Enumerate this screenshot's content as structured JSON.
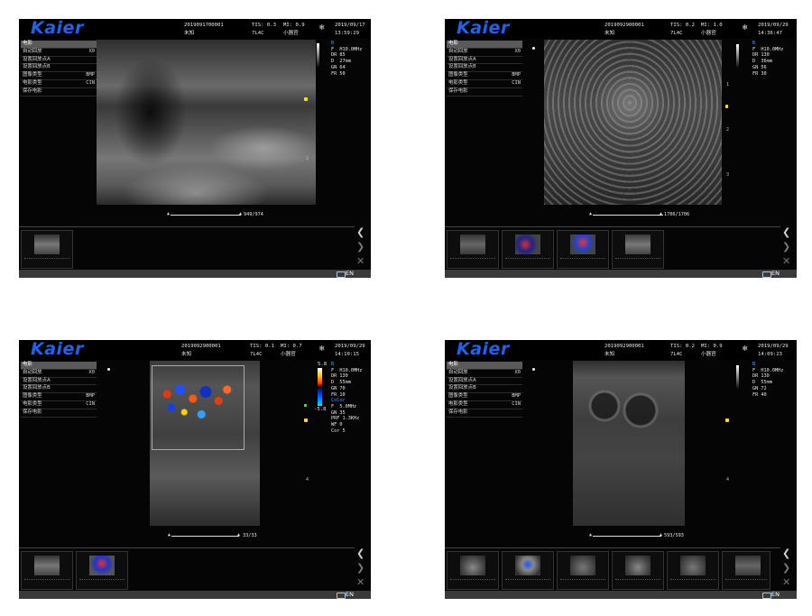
{
  "screens": [
    {
      "brand": "Kaier",
      "patient_id": "2019091700001",
      "patient_name": "未知",
      "tis": "TIS: 0.3",
      "mi": "MI: 0.9",
      "probe": "7L4C",
      "preset": "小器官",
      "date": "2019/09/17",
      "time": "13:59:29",
      "menu": [
        {
          "label": "电影",
          "value": ""
        },
        {
          "label": "自动回放",
          "value": "X0"
        },
        {
          "label": "设置回放点A",
          "value": ""
        },
        {
          "label": "设置回放点B",
          "value": ""
        },
        {
          "label": "图像类型",
          "value": "BMP"
        },
        {
          "label": "电影类型",
          "value": "CIN"
        },
        {
          "label": "保存电影",
          "value": ""
        }
      ],
      "params": [
        {
          "k": "B",
          "v": ""
        },
        {
          "k": "F",
          "v": "H10.0MHz"
        },
        {
          "k": "DR",
          "v": "85"
        },
        {
          "k": "D",
          "v": "27mm"
        },
        {
          "k": "GN",
          "v": "64"
        },
        {
          "k": "FR",
          "v": "50"
        }
      ],
      "depth_marks": [
        "1",
        "2"
      ],
      "cine_counter": "949/974",
      "thumbnails": 1,
      "lang": "EN"
    },
    {
      "brand": "Kaier",
      "patient_id": "2019092900001",
      "patient_name": "未知",
      "tis": "TIS: 0.2",
      "mi": "MI: 1.0",
      "probe": "7L4C",
      "preset": "小器官",
      "date": "2019/09/29",
      "time": "14:36:47",
      "menu": [
        {
          "label": "电影",
          "value": ""
        },
        {
          "label": "自动回放",
          "value": "X0"
        },
        {
          "label": "设置回放点A",
          "value": ""
        },
        {
          "label": "设置回放点B",
          "value": ""
        },
        {
          "label": "图像类型",
          "value": "BMP"
        },
        {
          "label": "电影类型",
          "value": "CIN"
        },
        {
          "label": "保存电影",
          "value": ""
        }
      ],
      "params": [
        {
          "k": "B",
          "v": ""
        },
        {
          "k": "F",
          "v": "H10.0MHz"
        },
        {
          "k": "DR",
          "v": "130"
        },
        {
          "k": "D",
          "v": "36mm"
        },
        {
          "k": "GN",
          "v": "56"
        },
        {
          "k": "FR",
          "v": "30"
        }
      ],
      "depth_marks": [
        "1",
        "2",
        "3"
      ],
      "cine_counter": "1706/1706",
      "thumbnails": 4,
      "lang": "EN"
    },
    {
      "brand": "Kaier",
      "patient_id": "2019092900001",
      "patient_name": "未知",
      "tis": "TIS: 0.1",
      "mi": "MI: 0.7",
      "probe": "7L4C",
      "preset": "小器官",
      "date": "2019/09/29",
      "time": "14:10:15",
      "menu": [
        {
          "label": "电影",
          "value": ""
        },
        {
          "label": "自动回放",
          "value": "X0"
        },
        {
          "label": "设置回放点A",
          "value": ""
        },
        {
          "label": "设置回放点B",
          "value": ""
        },
        {
          "label": "图像类型",
          "value": "BMP"
        },
        {
          "label": "电影类型",
          "value": "CIN"
        },
        {
          "label": "保存电影",
          "value": ""
        }
      ],
      "params": [
        {
          "k": "B",
          "v": ""
        },
        {
          "k": "F",
          "v": "H10.0MHz"
        },
        {
          "k": "DR",
          "v": "130"
        },
        {
          "k": "D",
          "v": "55mm"
        },
        {
          "k": "GN",
          "v": "70"
        },
        {
          "k": "FR",
          "v": "10"
        },
        {
          "k": "Color",
          "v": ""
        },
        {
          "k": "F",
          "v": "5.0MHz"
        },
        {
          "k": "GN",
          "v": "35"
        },
        {
          "k": "PRF",
          "v": "1.3KHz"
        },
        {
          "k": "WF",
          "v": "0"
        },
        {
          "k": "Cor",
          "v": "5"
        }
      ],
      "color_scale": {
        "top": "5.8",
        "bottom": "-5.8"
      },
      "depth_marks": [
        "4"
      ],
      "cine_counter": "33/33",
      "thumbnails": 2,
      "lang": "EN"
    },
    {
      "brand": "Kaier",
      "patient_id": "2019092900001",
      "patient_name": "未知",
      "tis": "TIS: 0.2",
      "mi": "MI: 0.9",
      "probe": "7L4C",
      "preset": "小器官",
      "date": "2019/09/29",
      "time": "14:09:23",
      "menu": [
        {
          "label": "电影",
          "value": ""
        },
        {
          "label": "自动回放",
          "value": "X0"
        },
        {
          "label": "设置回放点A",
          "value": ""
        },
        {
          "label": "设置回放点B",
          "value": ""
        },
        {
          "label": "图像类型",
          "value": "BMP"
        },
        {
          "label": "电影类型",
          "value": "CIN"
        },
        {
          "label": "保存电影",
          "value": ""
        }
      ],
      "params": [
        {
          "k": "B",
          "v": ""
        },
        {
          "k": "F",
          "v": "H10.0MHz"
        },
        {
          "k": "DR",
          "v": "130"
        },
        {
          "k": "D",
          "v": "55mm"
        },
        {
          "k": "GN",
          "v": "72"
        },
        {
          "k": "FR",
          "v": "40"
        }
      ],
      "depth_marks": [
        "4"
      ],
      "cine_counter": "593/593",
      "thumbnails": 6,
      "lang": "EN"
    }
  ]
}
